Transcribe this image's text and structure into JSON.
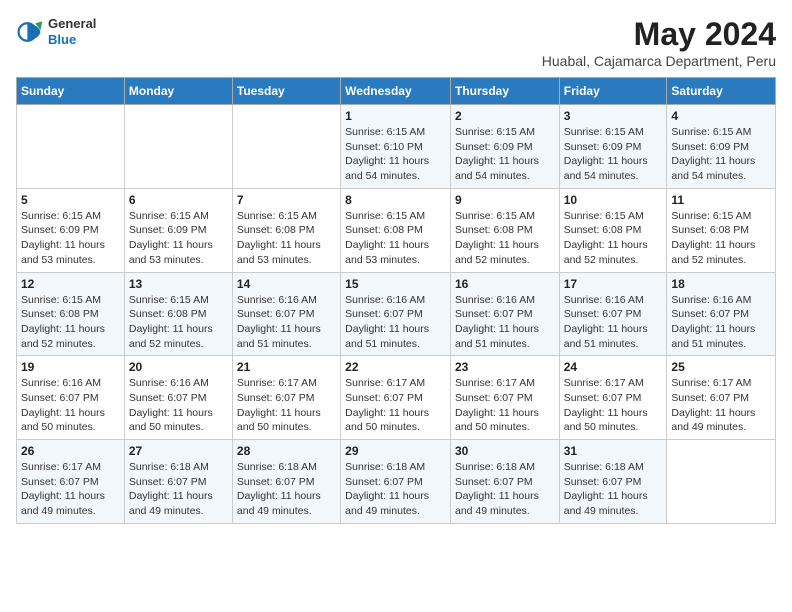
{
  "header": {
    "logo_general": "General",
    "logo_blue": "Blue",
    "month_year": "May 2024",
    "location": "Huabal, Cajamarca Department, Peru"
  },
  "weekdays": [
    "Sunday",
    "Monday",
    "Tuesday",
    "Wednesday",
    "Thursday",
    "Friday",
    "Saturday"
  ],
  "weeks": [
    [
      {
        "day": "",
        "info": ""
      },
      {
        "day": "",
        "info": ""
      },
      {
        "day": "",
        "info": ""
      },
      {
        "day": "1",
        "info": "Sunrise: 6:15 AM\nSunset: 6:10 PM\nDaylight: 11 hours\nand 54 minutes."
      },
      {
        "day": "2",
        "info": "Sunrise: 6:15 AM\nSunset: 6:09 PM\nDaylight: 11 hours\nand 54 minutes."
      },
      {
        "day": "3",
        "info": "Sunrise: 6:15 AM\nSunset: 6:09 PM\nDaylight: 11 hours\nand 54 minutes."
      },
      {
        "day": "4",
        "info": "Sunrise: 6:15 AM\nSunset: 6:09 PM\nDaylight: 11 hours\nand 54 minutes."
      }
    ],
    [
      {
        "day": "5",
        "info": "Sunrise: 6:15 AM\nSunset: 6:09 PM\nDaylight: 11 hours\nand 53 minutes."
      },
      {
        "day": "6",
        "info": "Sunrise: 6:15 AM\nSunset: 6:09 PM\nDaylight: 11 hours\nand 53 minutes."
      },
      {
        "day": "7",
        "info": "Sunrise: 6:15 AM\nSunset: 6:08 PM\nDaylight: 11 hours\nand 53 minutes."
      },
      {
        "day": "8",
        "info": "Sunrise: 6:15 AM\nSunset: 6:08 PM\nDaylight: 11 hours\nand 53 minutes."
      },
      {
        "day": "9",
        "info": "Sunrise: 6:15 AM\nSunset: 6:08 PM\nDaylight: 11 hours\nand 52 minutes."
      },
      {
        "day": "10",
        "info": "Sunrise: 6:15 AM\nSunset: 6:08 PM\nDaylight: 11 hours\nand 52 minutes."
      },
      {
        "day": "11",
        "info": "Sunrise: 6:15 AM\nSunset: 6:08 PM\nDaylight: 11 hours\nand 52 minutes."
      }
    ],
    [
      {
        "day": "12",
        "info": "Sunrise: 6:15 AM\nSunset: 6:08 PM\nDaylight: 11 hours\nand 52 minutes."
      },
      {
        "day": "13",
        "info": "Sunrise: 6:15 AM\nSunset: 6:08 PM\nDaylight: 11 hours\nand 52 minutes."
      },
      {
        "day": "14",
        "info": "Sunrise: 6:16 AM\nSunset: 6:07 PM\nDaylight: 11 hours\nand 51 minutes."
      },
      {
        "day": "15",
        "info": "Sunrise: 6:16 AM\nSunset: 6:07 PM\nDaylight: 11 hours\nand 51 minutes."
      },
      {
        "day": "16",
        "info": "Sunrise: 6:16 AM\nSunset: 6:07 PM\nDaylight: 11 hours\nand 51 minutes."
      },
      {
        "day": "17",
        "info": "Sunrise: 6:16 AM\nSunset: 6:07 PM\nDaylight: 11 hours\nand 51 minutes."
      },
      {
        "day": "18",
        "info": "Sunrise: 6:16 AM\nSunset: 6:07 PM\nDaylight: 11 hours\nand 51 minutes."
      }
    ],
    [
      {
        "day": "19",
        "info": "Sunrise: 6:16 AM\nSunset: 6:07 PM\nDaylight: 11 hours\nand 50 minutes."
      },
      {
        "day": "20",
        "info": "Sunrise: 6:16 AM\nSunset: 6:07 PM\nDaylight: 11 hours\nand 50 minutes."
      },
      {
        "day": "21",
        "info": "Sunrise: 6:17 AM\nSunset: 6:07 PM\nDaylight: 11 hours\nand 50 minutes."
      },
      {
        "day": "22",
        "info": "Sunrise: 6:17 AM\nSunset: 6:07 PM\nDaylight: 11 hours\nand 50 minutes."
      },
      {
        "day": "23",
        "info": "Sunrise: 6:17 AM\nSunset: 6:07 PM\nDaylight: 11 hours\nand 50 minutes."
      },
      {
        "day": "24",
        "info": "Sunrise: 6:17 AM\nSunset: 6:07 PM\nDaylight: 11 hours\nand 50 minutes."
      },
      {
        "day": "25",
        "info": "Sunrise: 6:17 AM\nSunset: 6:07 PM\nDaylight: 11 hours\nand 49 minutes."
      }
    ],
    [
      {
        "day": "26",
        "info": "Sunrise: 6:17 AM\nSunset: 6:07 PM\nDaylight: 11 hours\nand 49 minutes."
      },
      {
        "day": "27",
        "info": "Sunrise: 6:18 AM\nSunset: 6:07 PM\nDaylight: 11 hours\nand 49 minutes."
      },
      {
        "day": "28",
        "info": "Sunrise: 6:18 AM\nSunset: 6:07 PM\nDaylight: 11 hours\nand 49 minutes."
      },
      {
        "day": "29",
        "info": "Sunrise: 6:18 AM\nSunset: 6:07 PM\nDaylight: 11 hours\nand 49 minutes."
      },
      {
        "day": "30",
        "info": "Sunrise: 6:18 AM\nSunset: 6:07 PM\nDaylight: 11 hours\nand 49 minutes."
      },
      {
        "day": "31",
        "info": "Sunrise: 6:18 AM\nSunset: 6:07 PM\nDaylight: 11 hours\nand 49 minutes."
      },
      {
        "day": "",
        "info": ""
      }
    ]
  ]
}
